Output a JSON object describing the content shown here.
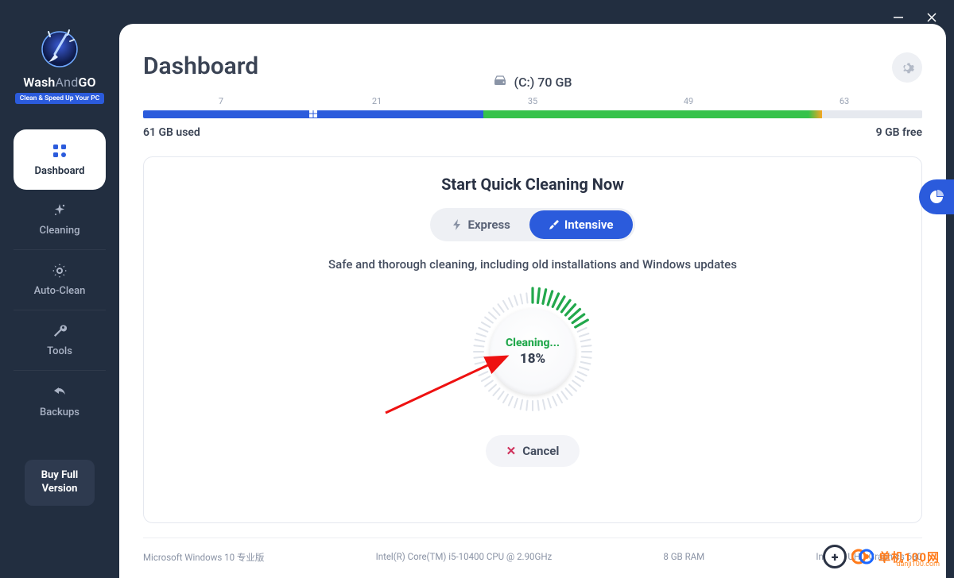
{
  "brand": {
    "p1": "Wash",
    "p2": "And",
    "p3": "GO",
    "tagline": "Clean & Speed Up Your PC"
  },
  "window": {
    "minimize": "−",
    "close": "×"
  },
  "sidebar": {
    "items": [
      {
        "label": "Dashboard"
      },
      {
        "label": "Cleaning"
      },
      {
        "label": "Auto-Clean"
      },
      {
        "label": "Tools"
      },
      {
        "label": "Backups"
      }
    ],
    "buy_line1": "Buy Full",
    "buy_line2": "Version"
  },
  "page": {
    "title": "Dashboard"
  },
  "disk": {
    "drive_label": "(C:) 70 GB",
    "ruler": [
      "7",
      "21",
      "35",
      "49",
      "63"
    ],
    "used_label": "61 GB used",
    "free_label": "9 GB free",
    "segments": {
      "blue_pct": 43.7,
      "green_pct": 43.3,
      "orange_pct": 0.1,
      "free_pct": 12.9
    }
  },
  "cleaning": {
    "title": "Start Quick Cleaning Now",
    "modes": {
      "express": "Express",
      "intensive": "Intensive",
      "active": "intensive"
    },
    "description": "Safe and thorough cleaning, including old installations and Windows updates",
    "status": "Cleaning...",
    "progress": 18,
    "progress_label": "18%",
    "cancel_label": "Cancel"
  },
  "sysinfo": {
    "os": "Microsoft Windows 10 专业版",
    "cpu": "Intel(R) Core(TM) i5-10400 CPU @ 2.90GHz",
    "ram": "8 GB RAM",
    "gpu": "Intel(R) UHD Graphics 630"
  },
  "watermark": {
    "brand": "单机100网",
    "sub": "danji100.com"
  },
  "colors": {
    "accent": "#2b5bdc",
    "green": "#22a84c"
  }
}
